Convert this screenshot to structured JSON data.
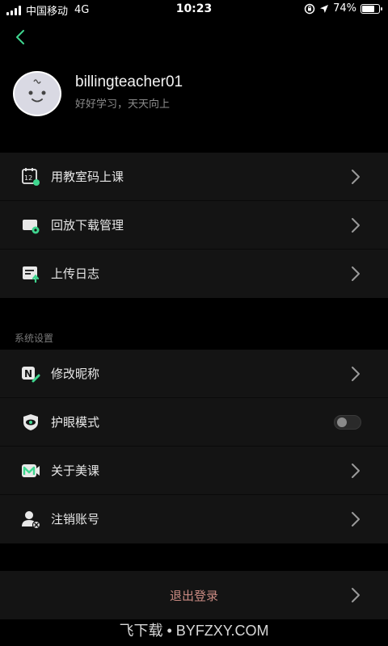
{
  "status_bar": {
    "carrier": "中国移动",
    "network": "4G",
    "time": "10:23",
    "battery_percent_text": "74%",
    "battery_level": 0.74
  },
  "profile": {
    "username": "billingteacher01",
    "signature": "好好学习，天天向上"
  },
  "menu_group_1": [
    {
      "label": "用教室码上课",
      "icon": "classroom-code-icon"
    },
    {
      "label": "回放下载管理",
      "icon": "playback-download-icon"
    },
    {
      "label": "上传日志",
      "icon": "upload-log-icon"
    }
  ],
  "system_settings": {
    "section_title": "系统设置",
    "items": [
      {
        "label": "修改昵称",
        "icon": "edit-nickname-icon"
      },
      {
        "label": "护眼模式",
        "icon": "eye-protection-icon",
        "toggle_on": false
      },
      {
        "label": "关于美课",
        "icon": "about-app-icon"
      },
      {
        "label": "注销账号",
        "icon": "delete-account-icon"
      }
    ]
  },
  "logout": {
    "label": "退出登录"
  },
  "watermark": "飞下载 • BYFZXY.COM",
  "colors": {
    "background": "#000000",
    "card": "#141414",
    "accent_green": "#3fd68f",
    "logout_text": "#c98a82"
  }
}
